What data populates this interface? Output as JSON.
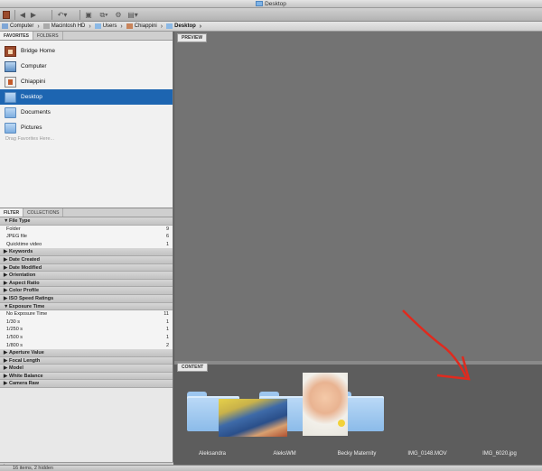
{
  "window": {
    "title": "Desktop"
  },
  "pathbar": {
    "crumbs": [
      "Computer",
      "Macintosh HD",
      "Users",
      "Chiappini",
      "Desktop"
    ]
  },
  "left_panel": {
    "tabs": [
      "FAVORITES",
      "FOLDERS"
    ],
    "favorites": [
      {
        "label": "Bridge Home",
        "icon": "bridge-home-icon"
      },
      {
        "label": "Computer",
        "icon": "computer-icon"
      },
      {
        "label": "Chiappini",
        "icon": "user-home-icon"
      },
      {
        "label": "Desktop",
        "icon": "folder-icon"
      },
      {
        "label": "Documents",
        "icon": "folder-icon"
      },
      {
        "label": "Pictures",
        "icon": "folder-icon"
      }
    ],
    "drag_hint": "Drag Favorites Here..."
  },
  "filter_panel": {
    "tabs": [
      "FILTER",
      "COLLECTIONS"
    ],
    "rows": [
      {
        "type": "head",
        "label": "File Type",
        "expanded": true
      },
      {
        "type": "item",
        "label": "Folder",
        "count": "9"
      },
      {
        "type": "item",
        "label": "JPEG file",
        "count": "6"
      },
      {
        "type": "item",
        "label": "Quicktime video",
        "count": "1"
      },
      {
        "type": "head",
        "label": "Keywords"
      },
      {
        "type": "head",
        "label": "Date Created"
      },
      {
        "type": "head",
        "label": "Date Modified"
      },
      {
        "type": "head",
        "label": "Orientation"
      },
      {
        "type": "head",
        "label": "Aspect Ratio"
      },
      {
        "type": "head",
        "label": "Color Profile"
      },
      {
        "type": "head",
        "label": "ISO Speed Ratings"
      },
      {
        "type": "head",
        "label": "Exposure Time",
        "expanded": true
      },
      {
        "type": "item",
        "label": "No Exposure Time",
        "count": "11"
      },
      {
        "type": "item",
        "label": "1/30 s",
        "count": "1"
      },
      {
        "type": "item",
        "label": "1/250 s",
        "count": "1"
      },
      {
        "type": "item",
        "label": "1/500 s",
        "count": "1"
      },
      {
        "type": "item",
        "label": "1/800 s",
        "count": "2"
      },
      {
        "type": "head",
        "label": "Aperture Value"
      },
      {
        "type": "head",
        "label": "Focal Length"
      },
      {
        "type": "head",
        "label": "Model"
      },
      {
        "type": "head",
        "label": "White Balance"
      },
      {
        "type": "head",
        "label": "Camera Raw"
      }
    ]
  },
  "preview": {
    "tab": "PREVIEW"
  },
  "content": {
    "tab": "CONTENT",
    "items": [
      {
        "name": "Aleksandra",
        "kind": "folder"
      },
      {
        "name": "AleksWM",
        "kind": "folder"
      },
      {
        "name": "Becky Maternity",
        "kind": "folder"
      },
      {
        "name": "IMG_0148.MOV",
        "kind": "video"
      },
      {
        "name": "IMG_6020.jpg",
        "kind": "photo"
      }
    ]
  },
  "status": {
    "text": "16 items, 2 hidden"
  },
  "colors": {
    "selection": "#1d65b1",
    "annotation_arrow": "#e02a1e"
  }
}
